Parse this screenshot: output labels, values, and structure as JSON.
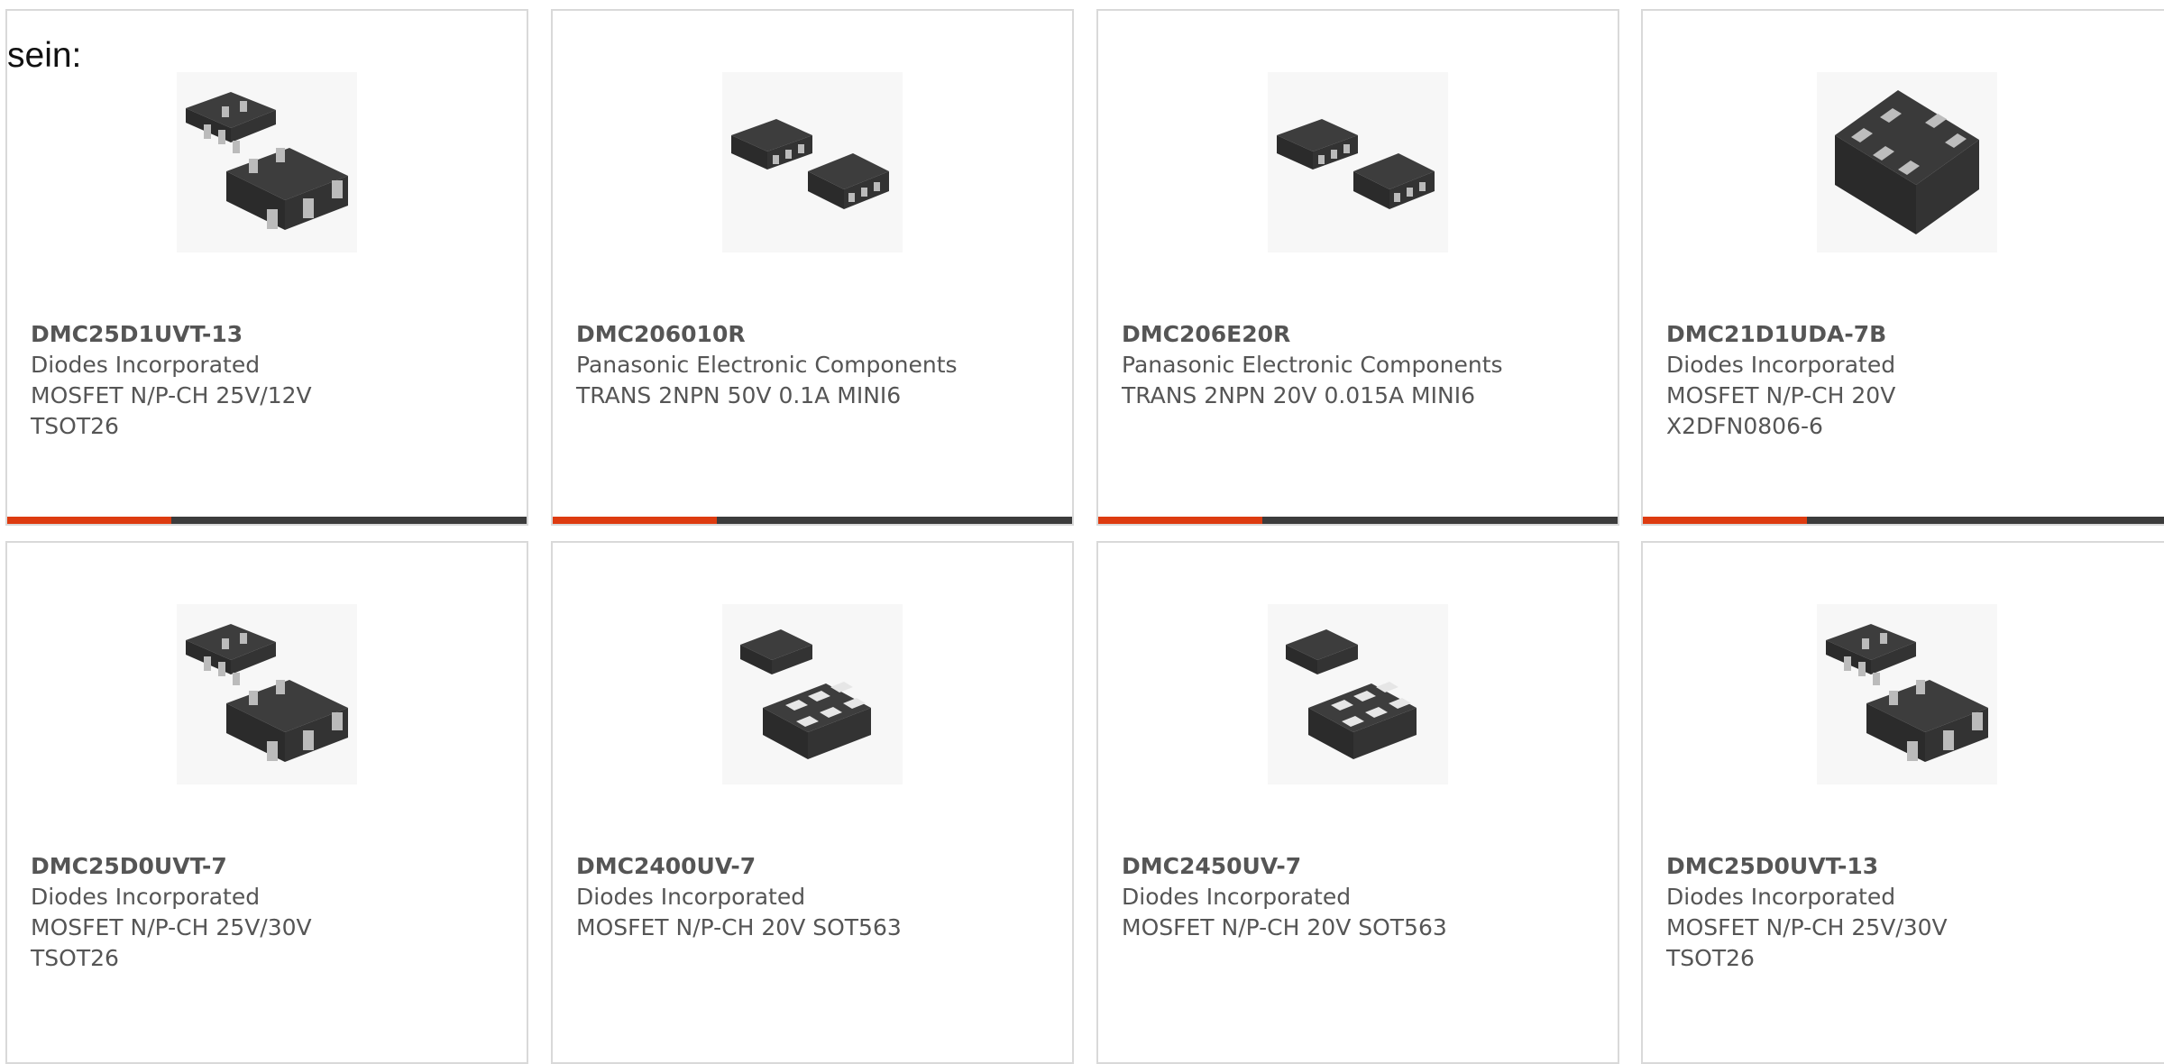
{
  "intro_text": "sein:",
  "colors": {
    "accent": "#dd3b10",
    "bar_dark": "#3c3c3c",
    "text": "#555555",
    "border": "#d9d9d9"
  },
  "products": [
    {
      "part_number": "DMC25D1UVT-13",
      "manufacturer": "Diodes Incorporated",
      "description_line1": "MOSFET N/P-CH 25V/12V",
      "description_line2": "TSOT26",
      "image_icon": "tsot26-package-icon"
    },
    {
      "part_number": "DMC206010R",
      "manufacturer": "Panasonic Electronic Components",
      "description_line1": "TRANS 2NPN 50V 0.1A MINI6",
      "description_line2": "",
      "image_icon": "mini6-package-icon"
    },
    {
      "part_number": "DMC206E20R",
      "manufacturer": "Panasonic Electronic Components",
      "description_line1": "TRANS 2NPN 20V 0.015A MINI6",
      "description_line2": "",
      "image_icon": "mini6-package-icon"
    },
    {
      "part_number": "DMC21D1UDA-7B",
      "manufacturer": "Diodes Incorporated",
      "description_line1": "MOSFET N/P-CH 20V",
      "description_line2": "X2DFN0806-6",
      "image_icon": "dfn-package-icon"
    },
    {
      "part_number": "DMC25D0UVT-7",
      "manufacturer": "Diodes Incorporated",
      "description_line1": "MOSFET N/P-CH 25V/30V",
      "description_line2": "TSOT26",
      "image_icon": "tsot26-package-icon"
    },
    {
      "part_number": "DMC2400UV-7",
      "manufacturer": "Diodes Incorporated",
      "description_line1": "MOSFET N/P-CH 20V SOT563",
      "description_line2": "",
      "image_icon": "sot563-package-icon"
    },
    {
      "part_number": "DMC2450UV-7",
      "manufacturer": "Diodes Incorporated",
      "description_line1": "MOSFET N/P-CH 20V SOT563",
      "description_line2": "",
      "image_icon": "sot563-package-icon"
    },
    {
      "part_number": "DMC25D0UVT-13",
      "manufacturer": "Diodes Incorporated",
      "description_line1": "MOSFET N/P-CH 25V/30V",
      "description_line2": "TSOT26",
      "image_icon": "tsot26-package-icon"
    }
  ]
}
